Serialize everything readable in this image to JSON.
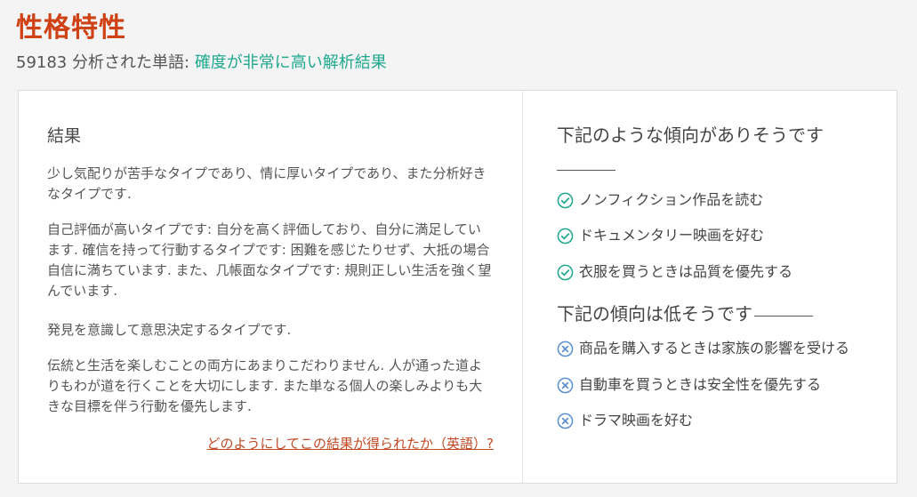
{
  "header": {
    "title": "性格特性",
    "word_count": "59183",
    "analyzed_label": "分析された単語:",
    "confidence": "確度が非常に高い解析結果"
  },
  "result": {
    "heading": "結果",
    "paragraphs": [
      "少し気配りが苦手なタイプであり、情に厚いタイプであり、また分析好きなタイプです.",
      "自己評価が高いタイプです: 自分を高く評価しており、自分に満足しています. 確信を持って行動するタイプです: 困難を感じたりせず、大抵の場合自信に満ちています. また、几帳面なタイプです: 規則正しい生活を強く望んでいます.",
      "発見を意識して意思決定するタイプです.",
      "伝統と生活を楽しむことの両方にあまりこだわりません. 人が通った道よりもわが道を行くことを大切にします. また単なる個人の楽しみよりも大きな目標を伴う行動を優先します."
    ],
    "how_link": "どのようにしてこの結果が得られたか（英語）?"
  },
  "likely": {
    "heading": "下記のような傾向がありそうです",
    "items": [
      "ノンフィクション作品を読む",
      "ドキュメンタリー映画を好む",
      "衣服を買うときは品質を優先する"
    ],
    "icon": "check-circle-icon",
    "icon_color": "#20a88f"
  },
  "unlikely": {
    "heading": "下記の傾向は低そうです",
    "items": [
      "商品を購入するときは家族の影響を受ける",
      "自動車を買うときは安全性を優先する",
      "ドラマ映画を好む"
    ],
    "icon": "x-circle-icon",
    "icon_color": "#5b8fd4"
  },
  "colors": {
    "title": "#cf4215",
    "confidence": "#20a88f",
    "link": "#c14a25"
  }
}
